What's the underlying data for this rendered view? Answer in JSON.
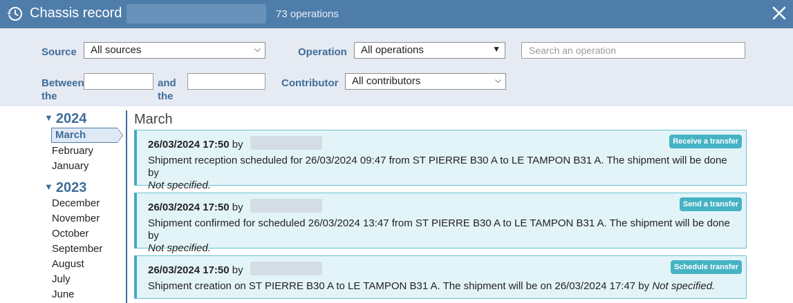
{
  "header": {
    "title": "Chassis record",
    "operations_count": "73 operations",
    "close_glyph": "✕"
  },
  "filters": {
    "source_label": "Source",
    "source_value": "All sources",
    "operation_label": "Operation",
    "operation_value": "All operations",
    "search_placeholder": "Search an operation",
    "between_label_1": "Between",
    "between_label_2": "the",
    "and_label_1": "and",
    "and_label_2": "the",
    "contributor_label": "Contributor",
    "contributor_value": "All contributors"
  },
  "sidebar": {
    "years": [
      {
        "year": "2024",
        "months": [
          "March",
          "February",
          "January"
        ]
      },
      {
        "year": "2023",
        "months": [
          "December",
          "November",
          "October",
          "September",
          "August",
          "July",
          "June"
        ]
      }
    ],
    "active_month": "March"
  },
  "main": {
    "month_heading": "March",
    "by_label": "by",
    "not_specified": "Not specified.",
    "entries": [
      {
        "datetime": "26/03/2024 17:50",
        "badge": "Receive a transfer",
        "text": "Shipment reception scheduled for 26/03/2024 09:47 from ST PIERRE B30 A to LE TAMPON B31 A. The shipment will be done by"
      },
      {
        "datetime": "26/03/2024 17:50",
        "badge": "Send a transfer",
        "text": "Shipment confirmed for scheduled 26/03/2024 13:47 from ST PIERRE B30 A to LE TAMPON B31 A. The shipment will be done by"
      },
      {
        "datetime": "26/03/2024 17:50",
        "badge": "Schedule transfer",
        "text": "Shipment creation on ST PIERRE B30 A to LE TAMPON B31 A. The shipment will be on 26/03/2024 17:47 by"
      }
    ]
  },
  "colors": {
    "header_bg": "#4f7daa",
    "accent": "#3f6c99",
    "card_bg": "#e3f4f8",
    "badge_bg": "#45b3c4"
  },
  "icons": [
    "history-icon",
    "close-icon",
    "chevron-down-icon",
    "expand-triangle-icon"
  ]
}
